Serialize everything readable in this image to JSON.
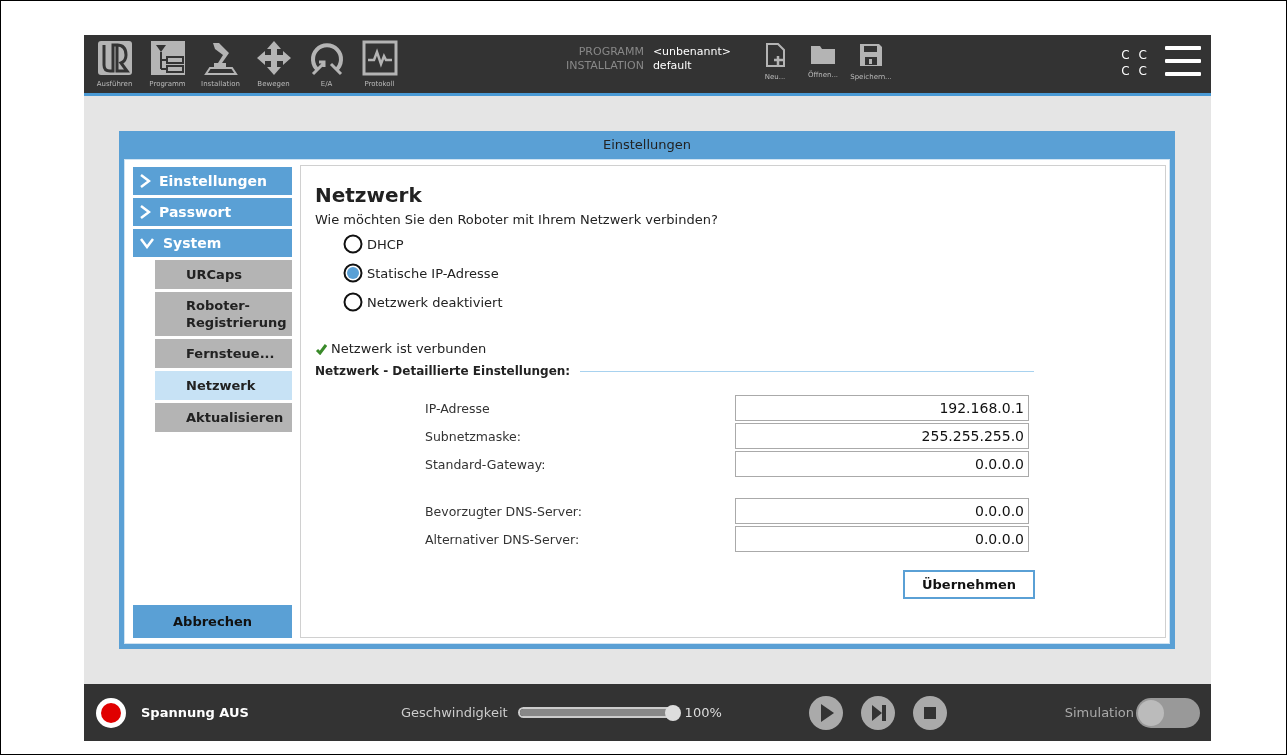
{
  "top_bar": {
    "nav_tabs": [
      {
        "label": "Ausführen",
        "kind": "run"
      },
      {
        "label": "Programm",
        "kind": "program"
      },
      {
        "label": "Installation",
        "kind": "installation"
      },
      {
        "label": "Bewegen",
        "kind": "move"
      },
      {
        "label": "E/A",
        "kind": "io"
      },
      {
        "label": "Protokoll",
        "kind": "log"
      }
    ],
    "program_label": "PROGRAMM",
    "program_value": "<unbenannt>",
    "installation_label": "INSTALLATION",
    "installation_value": "default",
    "file_buttons": [
      {
        "label": "Neu...",
        "kind": "new"
      },
      {
        "label": "Öffnen...",
        "kind": "open"
      },
      {
        "label": "Speichern...",
        "kind": "save"
      }
    ],
    "status_letters": [
      "C",
      "C",
      "C",
      "C"
    ]
  },
  "dialog": {
    "title": "Einstellungen"
  },
  "sidebar": {
    "items": [
      {
        "label": "Einstellungen",
        "expanded": false,
        "selected": false
      },
      {
        "label": "Passwort",
        "expanded": false,
        "selected": false
      },
      {
        "label": "System",
        "expanded": true,
        "selected": false,
        "children": [
          {
            "label": "URCaps",
            "selected": false
          },
          {
            "label": "Roboter-\nRegistrierung",
            "selected": false
          },
          {
            "label": "Fernsteue...",
            "selected": false
          },
          {
            "label": "Netzwerk",
            "selected": true
          },
          {
            "label": "Aktualisieren",
            "selected": false
          }
        ]
      }
    ],
    "cancel_button": "Abbrechen"
  },
  "content": {
    "title": "Netzwerk",
    "question": "Wie möchten Sie den Roboter mit Ihrem Netzwerk verbinden?",
    "options": [
      {
        "label": "DHCP",
        "selected": false
      },
      {
        "label": "Statische IP-Adresse",
        "selected": true
      },
      {
        "label": "Netzwerk deaktiviert",
        "selected": false
      }
    ],
    "status": "Netzwerk ist verbunden",
    "section_title": "Netzwerk - Detaillierte Einstellungen:",
    "field_groups": [
      [
        {
          "label": "IP-Adresse",
          "value": "192.168.0.1"
        },
        {
          "label": "Subnetzmaske:",
          "value": "255.255.255.0"
        },
        {
          "label": "Standard-Gateway:",
          "value": "0.0.0.0"
        }
      ],
      [
        {
          "label": "Bevorzugter DNS-Server:",
          "value": "0.0.0.0"
        },
        {
          "label": "Alternativer DNS-Server:",
          "value": "0.0.0.0"
        }
      ]
    ],
    "apply_button": "Übernehmen"
  },
  "bottom_bar": {
    "power_label": "Spannung AUS",
    "speed_label": "Geschwindigkeit",
    "speed": {
      "level": 1.0
    },
    "speed_reading": "100%",
    "simulation_label": "Simulation",
    "simulation": {
      "on": false
    }
  }
}
